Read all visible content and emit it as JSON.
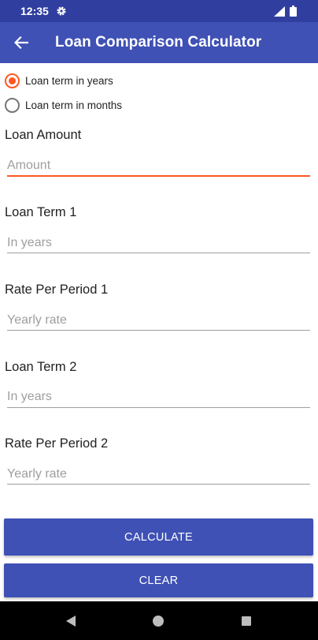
{
  "status_bar": {
    "time": "12:35",
    "icons": [
      "gear-icon",
      "signal-icon",
      "battery-icon"
    ]
  },
  "app_bar": {
    "title": "Loan Comparison Calculator",
    "back_icon": "arrow-left-icon"
  },
  "colors": {
    "primary": "#3f51b5",
    "primary_dark": "#303f9f",
    "accent": "#ff5722"
  },
  "term_unit": {
    "options": [
      {
        "label": "Loan term in years",
        "checked": true
      },
      {
        "label": "Loan term in months",
        "checked": false
      }
    ]
  },
  "fields": {
    "amount": {
      "label": "Loan Amount",
      "placeholder": "Amount",
      "value": ""
    },
    "term1": {
      "label": "Loan Term 1",
      "placeholder": "In years",
      "value": ""
    },
    "rate1": {
      "label": "Rate Per Period 1",
      "placeholder": "Yearly rate",
      "value": ""
    },
    "term2": {
      "label": "Loan Term 2",
      "placeholder": "In years",
      "value": ""
    },
    "rate2": {
      "label": "Rate Per Period 2",
      "placeholder": "Yearly rate",
      "value": ""
    }
  },
  "buttons": {
    "calculate": "CALCULATE",
    "clear": "CLEAR"
  },
  "nav_bar": {
    "icons": [
      "back-triangle-icon",
      "home-circle-icon",
      "recents-square-icon"
    ]
  }
}
